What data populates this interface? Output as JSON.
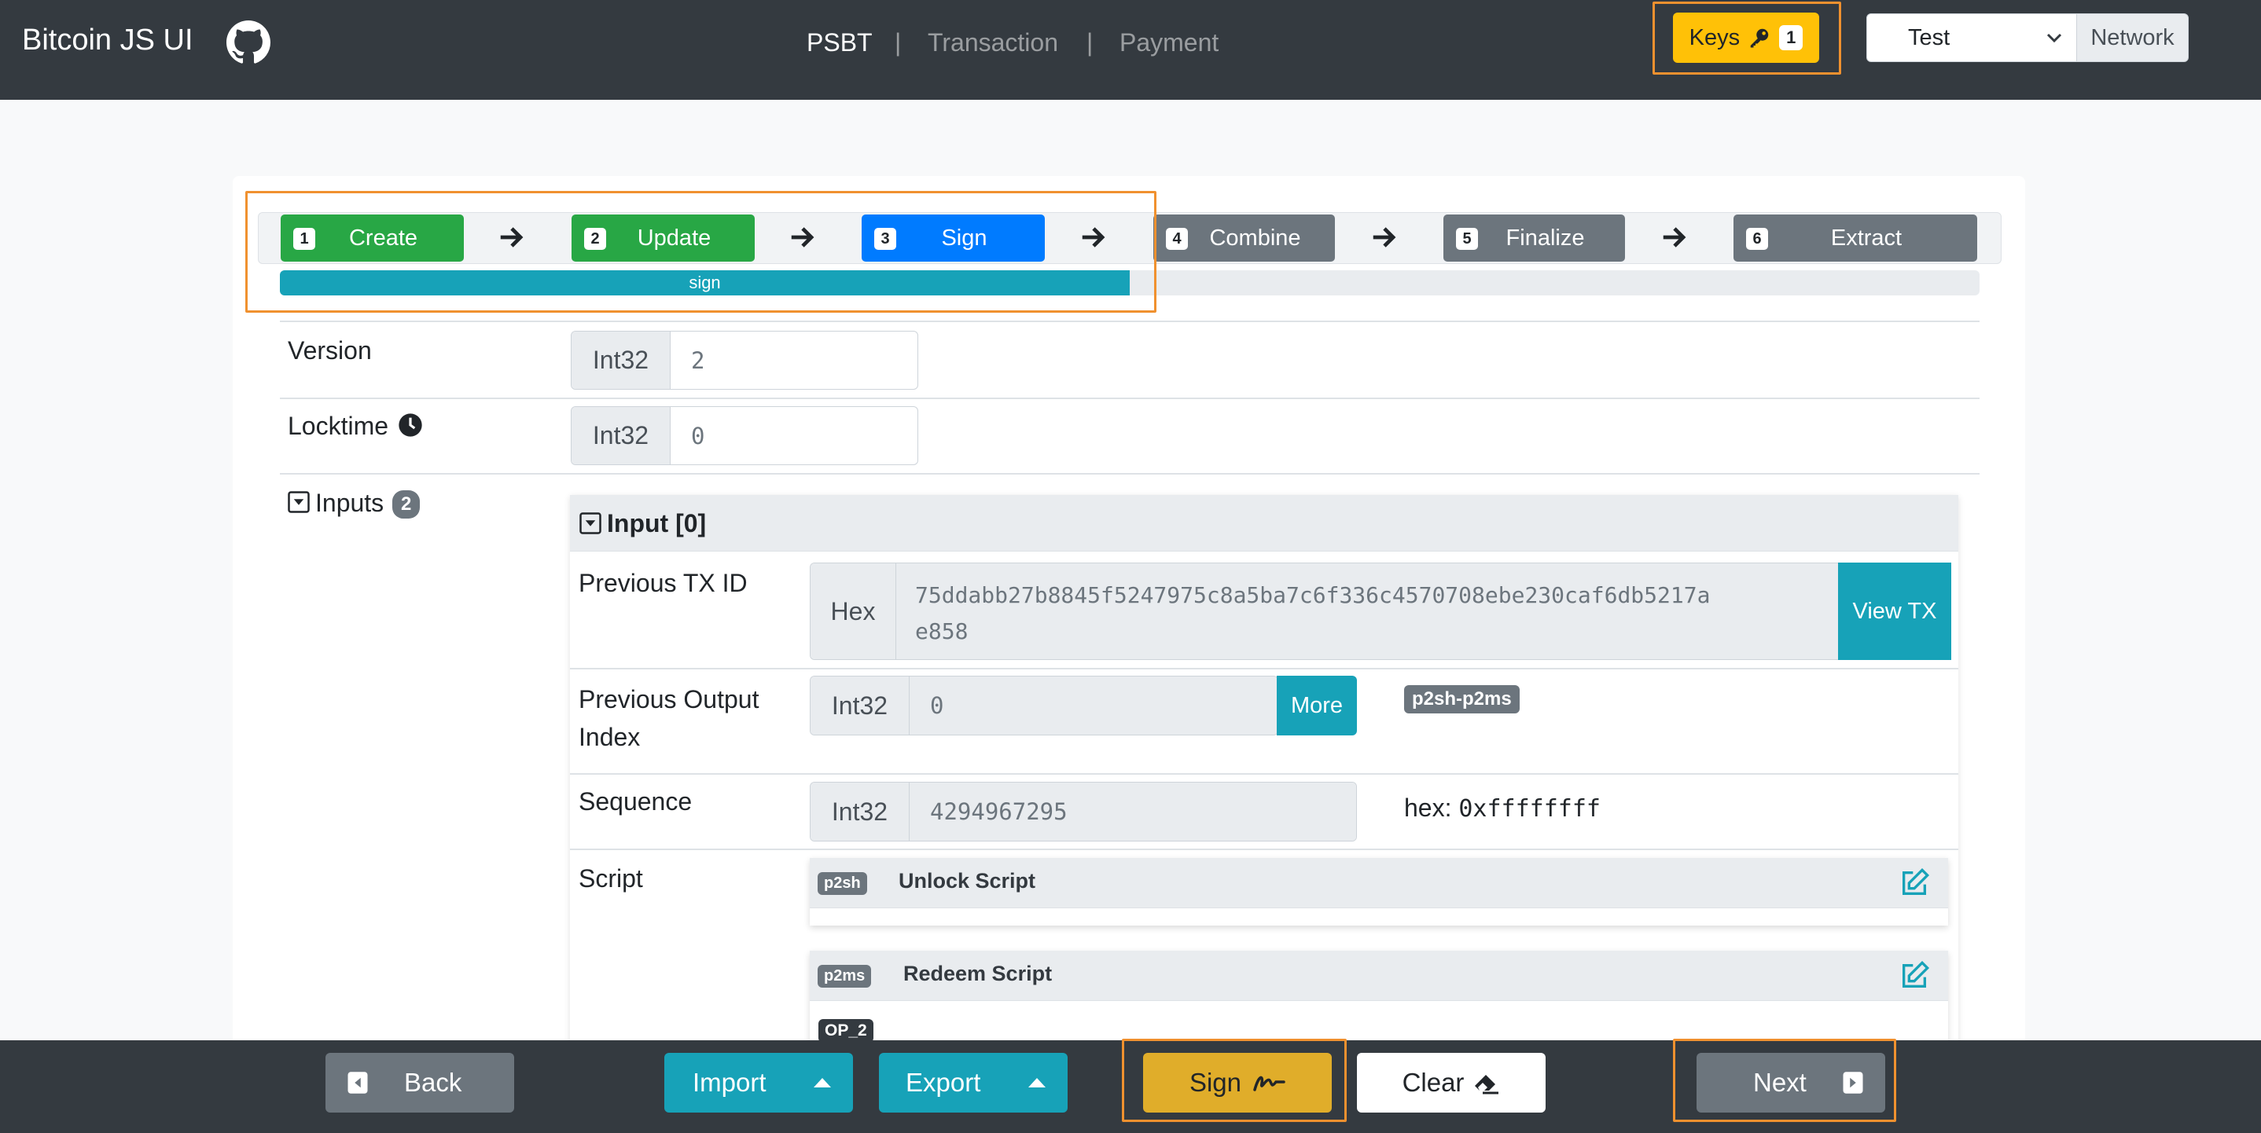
{
  "navbar": {
    "brand": "Bitcoin JS UI",
    "links": [
      "PSBT",
      "Transaction",
      "Payment"
    ],
    "separator": "|",
    "keys_label": "Keys",
    "keys_count": "1",
    "network_value": "Test",
    "network_label": "Network"
  },
  "steps": [
    {
      "num": "1",
      "label": "Create",
      "status": "done"
    },
    {
      "num": "2",
      "label": "Update",
      "status": "done"
    },
    {
      "num": "3",
      "label": "Sign",
      "status": "active"
    },
    {
      "num": "4",
      "label": "Combine",
      "status": "pending"
    },
    {
      "num": "5",
      "label": "Finalize",
      "status": "pending"
    },
    {
      "num": "6",
      "label": "Extract",
      "status": "pending"
    }
  ],
  "progress": {
    "label": "sign",
    "fraction": 0.5
  },
  "fields": {
    "version_label": "Version",
    "version_type": "Int32",
    "version_value": "2",
    "locktime_label": "Locktime",
    "locktime_type": "Int32",
    "locktime_value": "0",
    "inputs_label": "Inputs",
    "inputs_count": "2"
  },
  "input0": {
    "title": "Input [0]",
    "prev_txid_label": "Previous TX ID",
    "prev_txid_type": "Hex",
    "prev_txid_line1": "75ddabb27b8845f5247975c8a5ba7c6f336c4570708ebe230caf6db5217a",
    "prev_txid_line2": "e858",
    "view_tx_label": "View TX",
    "prev_out_label_1": "Previous Output",
    "prev_out_label_2": "Index",
    "prev_out_type": "Int32",
    "prev_out_value": "0",
    "more_label": "More",
    "script_type_badge": "p2sh-p2ms",
    "sequence_label": "Sequence",
    "sequence_type": "Int32",
    "sequence_value": "4294967295",
    "sequence_hex_label": "hex:",
    "sequence_hex_value": "0xffffffff",
    "script_label": "Script",
    "unlock_tag": "p2sh",
    "unlock_title": "Unlock Script",
    "redeem_tag": "p2ms",
    "redeem_title": "Redeem Script",
    "op_badge": "OP_2"
  },
  "bottom": {
    "back": "Back",
    "import": "Import",
    "export": "Export",
    "sign": "Sign",
    "clear": "Clear",
    "next": "Next"
  },
  "colors": {
    "navbar": "#343a40",
    "success": "#28a745",
    "primary": "#007bff",
    "secondary": "#6c757d",
    "info": "#17a2b8",
    "warning": "#ffc107",
    "highlight": "#f0912f"
  }
}
